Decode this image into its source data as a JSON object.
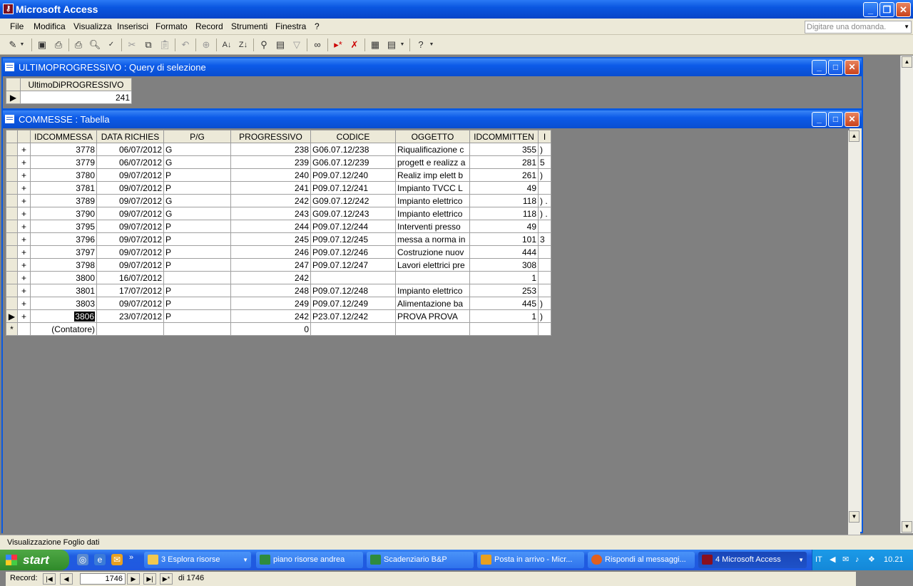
{
  "app": {
    "title": "Microsoft Access",
    "icon": "access-key-icon"
  },
  "menu": {
    "items": [
      "File",
      "Modifica",
      "Visualizza",
      "Inserisci",
      "Formato",
      "Record",
      "Strumenti",
      "Finestra",
      "?"
    ],
    "ask_placeholder": "Digitare una domanda."
  },
  "query_window": {
    "title": "ULTIMOPROGRESSIVO : Query di selezione",
    "column": "UltimoDiPROGRESSIVO",
    "value": "241"
  },
  "table_window": {
    "title": "COMMESSE : Tabella",
    "columns": [
      "IDCOMMESSA",
      "DATA RICHIES",
      "P/G",
      "PROGRESSIVO",
      "CODICE",
      "OGGETTO",
      "IDCOMMITTEN",
      "I"
    ],
    "rows": [
      [
        "3778",
        "06/07/2012",
        "G",
        "238",
        "G06.07.12/238",
        "Riqualificazione c",
        "355",
        ")"
      ],
      [
        "3779",
        "06/07/2012",
        "G",
        "239",
        "G06.07.12/239",
        "progett e realizz a",
        "281",
        "5"
      ],
      [
        "3780",
        "09/07/2012",
        "P",
        "240",
        "P09.07.12/240",
        "Realiz imp elett b",
        "261",
        ")"
      ],
      [
        "3781",
        "09/07/2012",
        "P",
        "241",
        "P09.07.12/241",
        "Impianto TVCC L",
        "49",
        ""
      ],
      [
        "3789",
        "09/07/2012",
        "G",
        "242",
        "G09.07.12/242",
        "Impianto elettrico",
        "118",
        ") ."
      ],
      [
        "3790",
        "09/07/2012",
        "G",
        "243",
        "G09.07.12/243",
        "Impianto elettrico",
        "118",
        ") ."
      ],
      [
        "3795",
        "09/07/2012",
        "P",
        "244",
        "P09.07.12/244",
        "Interventi presso",
        "49",
        ""
      ],
      [
        "3796",
        "09/07/2012",
        "P",
        "245",
        "P09.07.12/245",
        "messa a norma in",
        "101",
        "3"
      ],
      [
        "3797",
        "09/07/2012",
        "P",
        "246",
        "P09.07.12/246",
        "Costruzione nuov",
        "444",
        ""
      ],
      [
        "3798",
        "09/07/2012",
        "P",
        "247",
        "P09.07.12/247",
        "Lavori elettrici pre",
        "308",
        ""
      ],
      [
        "3800",
        "16/07/2012",
        "",
        "242",
        "",
        "",
        "1",
        ""
      ],
      [
        "3801",
        "17/07/2012",
        "P",
        "248",
        "P09.07.12/248",
        "Impianto elettrico",
        "253",
        ""
      ],
      [
        "3803",
        "09/07/2012",
        "P",
        "249",
        "P09.07.12/249",
        "Alimentazione ba",
        "445",
        ")"
      ],
      [
        "3806",
        "23/07/2012",
        "P",
        "242",
        "P23.07.12/242",
        "PROVA PROVA",
        "1",
        ")"
      ]
    ],
    "new_row": {
      "id": "(Contatore)",
      "progressivo": "0"
    },
    "record_label": "Record:",
    "record_current": "1746",
    "record_total": "di 1746"
  },
  "status": "Visualizzazione Foglio dati",
  "taskbar": {
    "start": "start",
    "tasks": [
      "3 Esplora risorse",
      "piano risorse andrea",
      "Scadenziario B&P",
      "Posta in arrivo - Micr...",
      "Rispondi al messaggi...",
      "4 Microsoft Access"
    ],
    "lang": "IT",
    "clock": "10.21"
  },
  "colors": {
    "title_blue": "#0a56e0",
    "chrome": "#ece9d8",
    "mdi": "#808080",
    "start_green": "#3c9a34"
  }
}
